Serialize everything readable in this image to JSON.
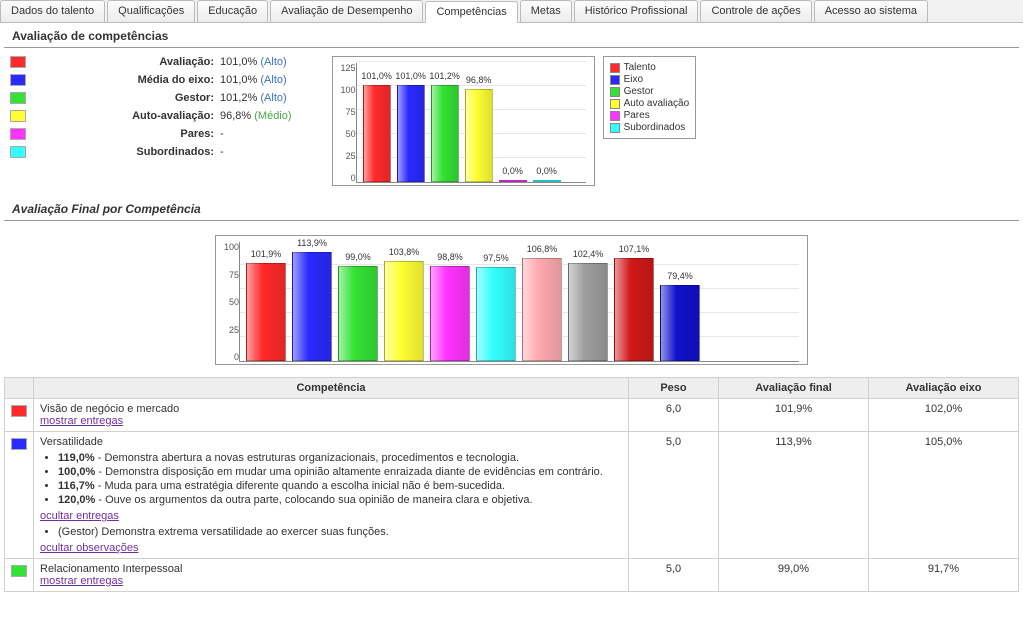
{
  "tabs": [
    {
      "label": "Dados do talento"
    },
    {
      "label": "Qualificações"
    },
    {
      "label": "Educação"
    },
    {
      "label": "Avaliação de Desempenho"
    },
    {
      "label": "Competências",
      "active": true
    },
    {
      "label": "Metas"
    },
    {
      "label": "Histórico Profissional"
    },
    {
      "label": "Controle de ações"
    },
    {
      "label": "Acesso ao sistema"
    }
  ],
  "section1_title": "Avaliação de competências",
  "metrics": [
    {
      "color": "#ff2a2a",
      "label": "Avaliação:",
      "value": "101,0%",
      "qual": "(Alto)",
      "qualClass": "qual"
    },
    {
      "color": "#2a2aff",
      "label": "Média do eixo:",
      "value": "101,0%",
      "qual": "(Alto)",
      "qualClass": "qual"
    },
    {
      "color": "#33e233",
      "label": "Gestor:",
      "value": "101,2%",
      "qual": "(Alto)",
      "qualClass": "qual"
    },
    {
      "color": "#ffff33",
      "label": "Auto-avaliação:",
      "value": "96,8%",
      "qual": "(Médio)",
      "qualClass": "qual med"
    },
    {
      "color": "#ff33ff",
      "label": "Pares:",
      "value": "-",
      "qual": "",
      "qualClass": ""
    },
    {
      "color": "#33ffff",
      "label": "Subordinados:",
      "value": "-",
      "qual": "",
      "qualClass": ""
    }
  ],
  "legend": [
    {
      "color": "#ff2a2a",
      "label": "Talento"
    },
    {
      "color": "#2a2aff",
      "label": "Eixo"
    },
    {
      "color": "#33e233",
      "label": "Gestor"
    },
    {
      "color": "#ffff33",
      "label": "Auto avaliação"
    },
    {
      "color": "#ff33ff",
      "label": "Pares"
    },
    {
      "color": "#33ffff",
      "label": "Subordinados"
    }
  ],
  "section2_title": "Avaliação Final por Competência",
  "table_headers": {
    "comp": "Competência",
    "peso": "Peso",
    "final": "Avaliação final",
    "eixo": "Avaliação eixo"
  },
  "rows": [
    {
      "color": "#ff2a2a",
      "title": "Visão de negócio e mercado",
      "links": [
        {
          "text": "mostrar entregas"
        }
      ],
      "peso": "6,0",
      "final": "101,9%",
      "eixo": "102,0%"
    },
    {
      "color": "#2a2aff",
      "title": "Versatilidade",
      "bullets": [
        {
          "pct": "119,0%",
          "text": " - Demonstra abertura a novas estruturas organizacionais, procedimentos e tecnologia."
        },
        {
          "pct": "100,0%",
          "text": " - Demonstra disposição em mudar uma opinião altamente enraizada diante de evidências em contrário."
        },
        {
          "pct": "116,7%",
          "text": " - Muda para uma estratégia diferente quando a escolha inicial não é bem-sucedida."
        },
        {
          "pct": "120,0%",
          "text": " - Ouve os argumentos da outra parte, colocando sua opinião de maneira clara e objetiva."
        }
      ],
      "link1": "ocultar entregas",
      "note_bullet": "(Gestor) Demonstra extrema versatilidade ao exercer suas funções.",
      "link2": "ocultar observações",
      "peso": "5,0",
      "final": "113,9%",
      "eixo": "105,0%"
    },
    {
      "color": "#33e233",
      "title": "Relacionamento Interpessoal",
      "links": [
        {
          "text": "mostrar entregas"
        }
      ],
      "peso": "5,0",
      "final": "99,0%",
      "eixo": "91,7%"
    }
  ],
  "chart_data": [
    {
      "type": "bar",
      "title": "",
      "ylabel": "",
      "xlabel": "",
      "ylim": [
        0,
        125
      ],
      "ticks": [
        0,
        25,
        50,
        75,
        100,
        125
      ],
      "categories": [
        "Talento",
        "Eixo",
        "Gestor",
        "Auto avaliação",
        "Pares",
        "Subordinados"
      ],
      "values": [
        101.0,
        101.0,
        101.2,
        96.8,
        0.0,
        0.0
      ],
      "value_labels": [
        "101,0%",
        "101,0%",
        "101,2%",
        "96,8%",
        "0,0%",
        "0,0%"
      ],
      "colors": [
        "#ff2a2a",
        "#2a2aff",
        "#33e233",
        "#ffff33",
        "#ff33ff",
        "#33ffff"
      ]
    },
    {
      "type": "bar",
      "title": "Avaliação Final por Competência",
      "ylabel": "",
      "xlabel": "",
      "ylim": [
        0,
        125
      ],
      "ticks": [
        0,
        25,
        50,
        75,
        100
      ],
      "values": [
        101.9,
        113.9,
        99.0,
        103.8,
        98.8,
        97.5,
        106.8,
        102.4,
        107.1,
        79.4
      ],
      "value_labels": [
        "101,9%",
        "113,9%",
        "99,0%",
        "103,8%",
        "98,8%",
        "97,5%",
        "106,8%",
        "102,4%",
        "107,1%",
        "79,4%"
      ],
      "colors": [
        "#ff2a2a",
        "#2a2aff",
        "#33e233",
        "#ffff33",
        "#ff33ff",
        "#33ffff",
        "#ffaab0",
        "#9e9e9e",
        "#d11919",
        "#1111cc"
      ]
    }
  ]
}
